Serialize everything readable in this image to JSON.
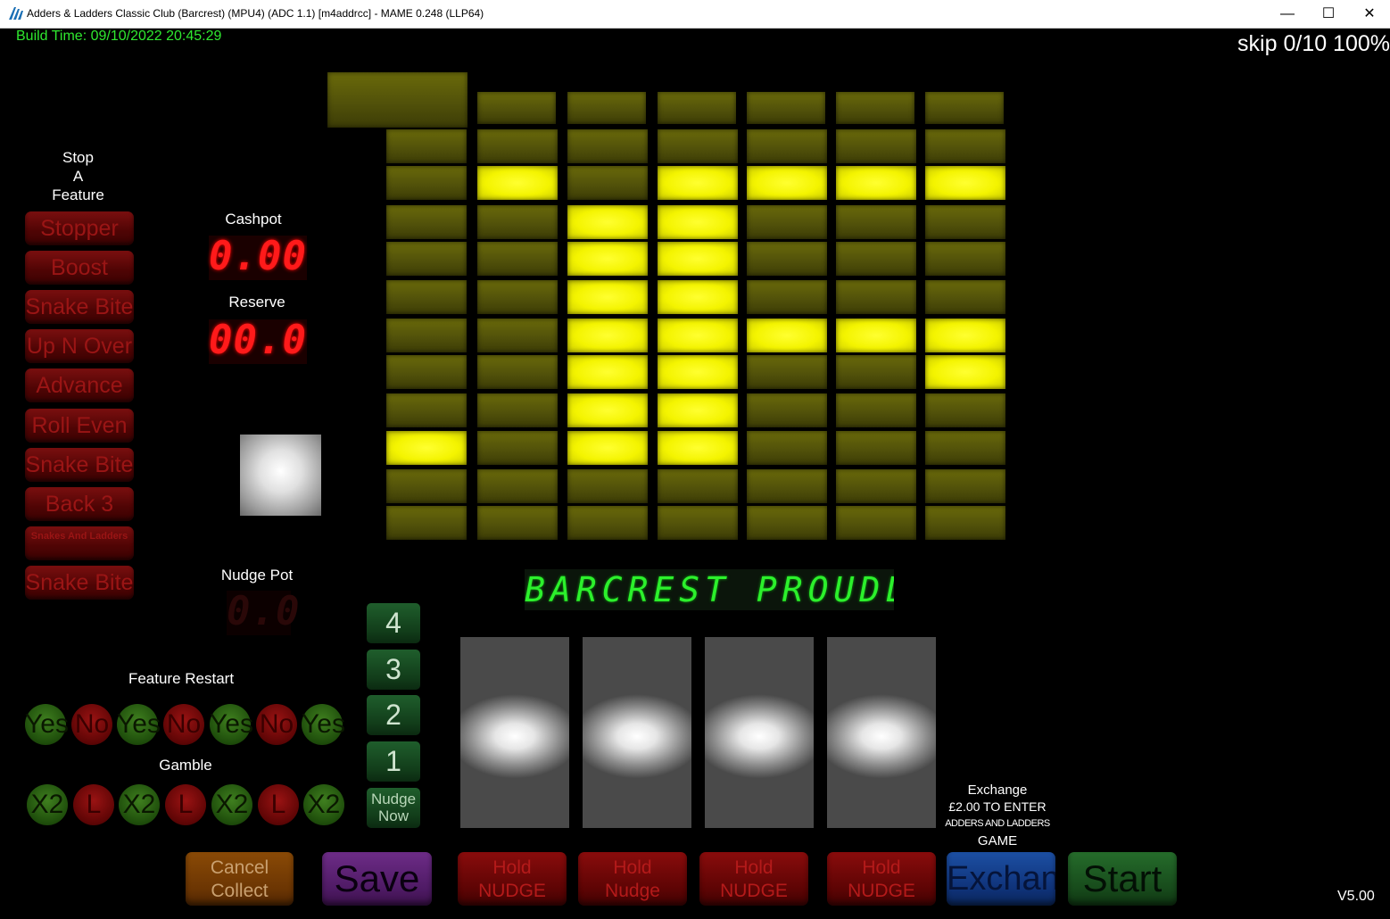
{
  "window": {
    "title": "Adders & Ladders Classic Club (Barcrest) (MPU4) (ADC 1.1) [m4addrcc] - MAME 0.248 (LLP64)",
    "minimize_glyph": "—",
    "maximize_glyph": "☐",
    "close_glyph": "✕",
    "icon": "mame-logo-icon"
  },
  "overlay": {
    "build_time": "Build Time: 09/10/2022 20:45:29",
    "skip_status": "skip 0/10 100%",
    "version": "V5.00"
  },
  "stop_feature": {
    "heading_line1": "Stop",
    "heading_line2": "A",
    "heading_line3": "Feature",
    "buttons": [
      "Stopper",
      "Boost",
      "Snake Bite",
      "Up N Over",
      "Advance",
      "Roll Even",
      "Snake Bite",
      "Back 3",
      "Snakes And Ladders",
      "Snake Bite"
    ]
  },
  "meters": {
    "cashpot_label": "Cashpot",
    "cashpot_value": "0.00",
    "reserve_label": "Reserve",
    "reserve_value": "00.0",
    "nudge_pot_label": "Nudge Pot",
    "nudge_pot_value": "0.0"
  },
  "lamp_grid": {
    "lit_color": "#f4f400",
    "unlit_color": "#52520a",
    "rows": [
      [
        0,
        1,
        0,
        1,
        1,
        1,
        1
      ],
      [
        0,
        0,
        1,
        1,
        0,
        0,
        0
      ],
      [
        0,
        0,
        1,
        1,
        0,
        0,
        0
      ],
      [
        0,
        0,
        1,
        1,
        0,
        0,
        0
      ],
      [
        0,
        0,
        1,
        1,
        1,
        1,
        1
      ],
      [
        0,
        0,
        1,
        1,
        0,
        0,
        1
      ],
      [
        0,
        0,
        1,
        1,
        0,
        0,
        0
      ],
      [
        1,
        0,
        1,
        1,
        0,
        0,
        0
      ]
    ]
  },
  "dot_matrix": {
    "text": "BARCREST PROUDLY"
  },
  "nudge_numbers": {
    "items": [
      "4",
      "3",
      "2",
      "1"
    ],
    "nudge_now_line1": "Nudge",
    "nudge_now_line2": "Now"
  },
  "feature_restart": {
    "label": "Feature Restart",
    "items": [
      "Yes",
      "No",
      "Yes",
      "No",
      "Yes",
      "No",
      "Yes"
    ]
  },
  "gamble": {
    "label": "Gamble",
    "items": [
      "X2",
      "L",
      "X2",
      "L",
      "X2",
      "L",
      "X2"
    ]
  },
  "exchange_info": {
    "line1": "Exchange",
    "line2": "£2.00 TO ENTER",
    "line3": "ADDERS AND LADDERS",
    "line4": "GAME"
  },
  "bottom_buttons": {
    "cancel_line1": "Cancel",
    "cancel_line2": "Collect",
    "save_it": "Save It",
    "hold1_line1": "Hold",
    "hold1_line2": "NUDGE",
    "hold2_line1": "Hold",
    "hold2_line2": "Nudge",
    "hold3_line1": "Hold",
    "hold3_line2": "NUDGE",
    "hold4_line1": "Hold",
    "hold4_line2": "NUDGE",
    "exchange": "Exchange",
    "start": "Start"
  }
}
